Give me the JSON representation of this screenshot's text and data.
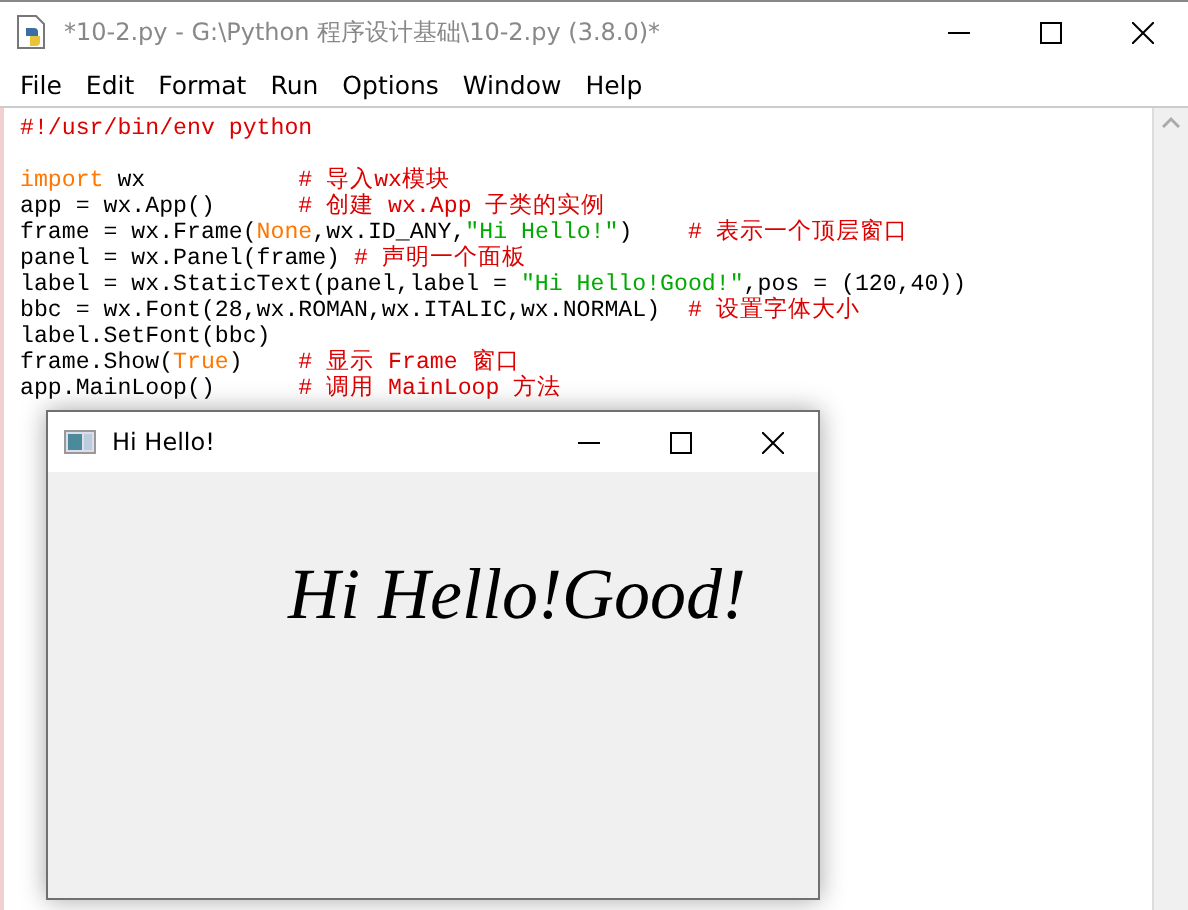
{
  "window": {
    "title": "*10-2.py - G:\\Python 程序设计基础\\10-2.py (3.8.0)*"
  },
  "menu": [
    {
      "label": "File"
    },
    {
      "label": "Edit"
    },
    {
      "label": "Format"
    },
    {
      "label": "Run"
    },
    {
      "label": "Options"
    },
    {
      "label": "Window"
    },
    {
      "label": "Help"
    }
  ],
  "editor": {
    "lines": [
      {
        "blank_after": true,
        "segments": [
          {
            "kind": "comment",
            "text": "#!/usr/bin/env python"
          }
        ]
      },
      {
        "blank_after": false,
        "segments": [
          {
            "kind": "keyword",
            "text": "import"
          },
          {
            "kind": "plain",
            "text": " wx           "
          },
          {
            "kind": "comment",
            "text": "# 导入wx模块"
          }
        ]
      },
      {
        "blank_after": false,
        "segments": [
          {
            "kind": "plain",
            "text": "app = wx.App()      "
          },
          {
            "kind": "comment",
            "text": "# 创建 wx.App 子类的实例"
          }
        ]
      },
      {
        "blank_after": false,
        "segments": [
          {
            "kind": "plain",
            "text": "frame = wx.Frame("
          },
          {
            "kind": "keyword",
            "text": "None"
          },
          {
            "kind": "plain",
            "text": ",wx.ID_ANY,"
          },
          {
            "kind": "string",
            "text": "\"Hi Hello!\""
          },
          {
            "kind": "plain",
            "text": ")    "
          },
          {
            "kind": "comment",
            "text": "# 表示一个顶层窗口"
          }
        ]
      },
      {
        "blank_after": false,
        "segments": [
          {
            "kind": "plain",
            "text": "panel = wx.Panel(frame) "
          },
          {
            "kind": "comment",
            "text": "# 声明一个面板"
          }
        ]
      },
      {
        "blank_after": false,
        "segments": [
          {
            "kind": "plain",
            "text": "label = wx.StaticText(panel,label = "
          },
          {
            "kind": "string",
            "text": "\"Hi Hello!Good!\""
          },
          {
            "kind": "plain",
            "text": ",pos = (120,40))"
          }
        ]
      },
      {
        "blank_after": false,
        "segments": [
          {
            "kind": "plain",
            "text": "bbc = wx.Font(28,wx.ROMAN,wx.ITALIC,wx.NORMAL)  "
          },
          {
            "kind": "comment",
            "text": "# 设置字体大小"
          }
        ]
      },
      {
        "blank_after": false,
        "segments": [
          {
            "kind": "plain",
            "text": "label.SetFont(bbc)"
          }
        ]
      },
      {
        "blank_after": false,
        "segments": [
          {
            "kind": "plain",
            "text": "frame.Show("
          },
          {
            "kind": "keyword",
            "text": "True"
          },
          {
            "kind": "plain",
            "text": ")    "
          },
          {
            "kind": "comment",
            "text": "# 显示 Frame 窗口"
          }
        ]
      },
      {
        "blank_after": false,
        "segments": [
          {
            "kind": "plain",
            "text": "app.MainLoop()      "
          },
          {
            "kind": "comment",
            "text": "# 调用 MainLoop 方法"
          }
        ]
      }
    ]
  },
  "app_window": {
    "title": "Hi Hello!",
    "label": "Hi Hello!Good!"
  }
}
